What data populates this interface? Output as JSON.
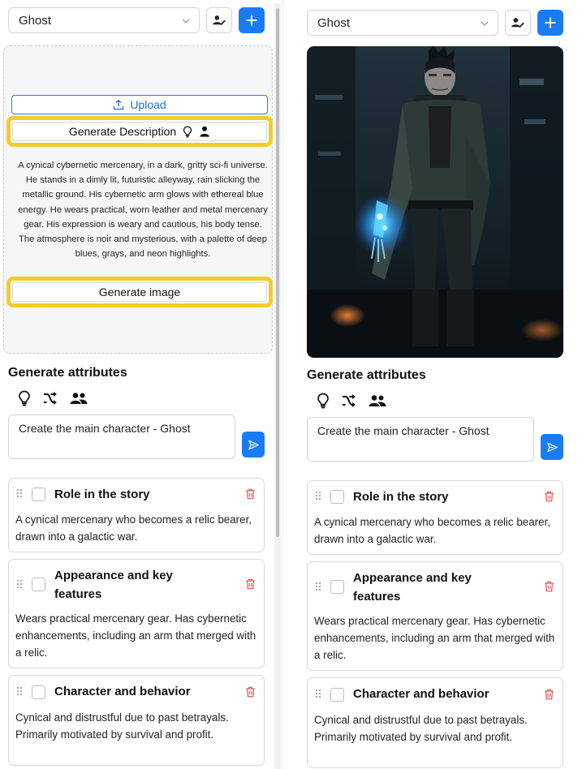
{
  "colors": {
    "accent": "#1a7cf5",
    "highlight": "#f2cc2c",
    "danger": "#e5484d"
  },
  "left_panel": {
    "character_select": {
      "value": "Ghost"
    },
    "upload": {
      "label": "Upload",
      "icon": "upload-icon"
    },
    "generate_description": {
      "label": "Generate Description",
      "icons": [
        "lightbulb-icon",
        "person-icon"
      ]
    },
    "description": "A cynical cybernetic mercenary, in a dark, gritty sci-fi universe. He stands in a dimly lit, futuristic alleyway, rain slicking the metallic ground. His cybernetic arm glows with ethereal blue energy. He wears practical, worn leather and metal mercenary gear. His expression is weary and cautious, his body tense. The atmosphere is noir and mysterious, with a palette of deep blues, grays, and neon highlights.",
    "generate_image": {
      "label": "Generate image"
    },
    "attributes_title": "Generate attributes",
    "attribute_icons": [
      "lightbulb-icon",
      "shuffle-icon",
      "people-icon"
    ],
    "prompt_value": "Create the main character - Ghost",
    "cards": [
      {
        "title": "Role in the story",
        "body": "A cynical mercenary who becomes a relic bearer, drawn into a galactic war."
      },
      {
        "title": "Appearance and key features",
        "body": "Wears practical mercenary gear. Has cybernetic enhancements, including an arm that merged with a relic."
      },
      {
        "title": "Character and behavior",
        "body": "Cynical and distrustful due to past betrayals. Primarily motivated by survival and profit."
      }
    ]
  },
  "right_panel": {
    "character_select": {
      "value": "Ghost"
    },
    "portrait": {
      "subject": "cyberpunk mercenary with glowing blue cybernetic arm in a dark rainy alley"
    },
    "attributes_title": "Generate attributes",
    "attribute_icons": [
      "lightbulb-icon",
      "shuffle-icon",
      "people-icon"
    ],
    "prompt_value": "Create the main character - Ghost",
    "cards": [
      {
        "title": "Role in the story",
        "body": "A cynical mercenary who becomes a relic bearer, drawn into a galactic war."
      },
      {
        "title": "Appearance and key features",
        "body": "Wears practical mercenary gear. Has cybernetic enhancements, including an arm that merged with a relic."
      },
      {
        "title": "Character and behavior",
        "body": "Cynical and distrustful due to past betrayals. Primarily motivated by survival and profit."
      }
    ]
  }
}
